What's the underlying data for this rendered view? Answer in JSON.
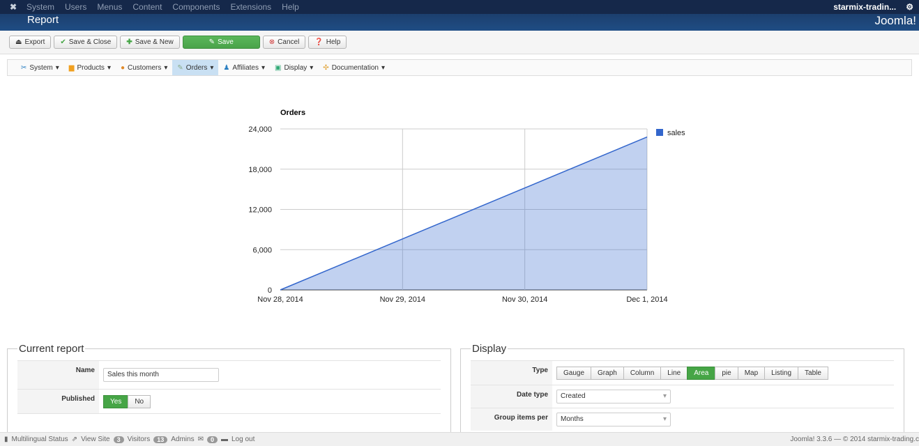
{
  "topnav": {
    "items": [
      "System",
      "Users",
      "Menus",
      "Content",
      "Components",
      "Extensions",
      "Help"
    ],
    "site": "starmix-tradin...",
    "settings_icon": "gear-icon"
  },
  "header": {
    "title": "Report",
    "brand": "Joomla!"
  },
  "toolbar": {
    "export": "Export",
    "save_close": "Save & Close",
    "save_new": "Save & New",
    "save": "Save",
    "cancel": "Cancel",
    "help": "Help"
  },
  "submenu": [
    "System",
    "Products",
    "Customers",
    "Orders",
    "Affiliates",
    "Display",
    "Documentation"
  ],
  "chart_data": {
    "type": "area",
    "title": "Orders",
    "categories": [
      "Nov 28, 2014",
      "Nov 29, 2014",
      "Nov 30, 2014",
      "Dec 1, 2014"
    ],
    "series": [
      {
        "name": "sales",
        "values": [
          0,
          7600,
          15200,
          22800
        ],
        "color": "#3366cc"
      }
    ],
    "ylim": [
      0,
      24000
    ],
    "yticks": [
      "0",
      "6,000",
      "12,000",
      "18,000",
      "24,000"
    ],
    "legend": "right",
    "grid": true
  },
  "current": {
    "legend": "Current report",
    "name_label": "Name",
    "name_value": "Sales this month",
    "published_label": "Published",
    "yes": "Yes",
    "no": "No"
  },
  "display": {
    "legend": "Display",
    "type_label": "Type",
    "types": [
      "Gauge",
      "Graph",
      "Column",
      "Line",
      "Area",
      "pie",
      "Map",
      "Listing",
      "Table"
    ],
    "active_type": "Area",
    "date_type_label": "Date type",
    "date_type": "Created",
    "group_label": "Group items per",
    "group": "Months"
  },
  "footer": {
    "multilingual": "Multilingual Status",
    "view_site": "View Site",
    "visitors_count": "3",
    "visitors": "Visitors",
    "admins_count": "13",
    "admins": "Admins",
    "messages_count": "0",
    "logout": "Log out",
    "version": "Joomla! 3.3.6 — © 2014 starmix-trading.c"
  }
}
